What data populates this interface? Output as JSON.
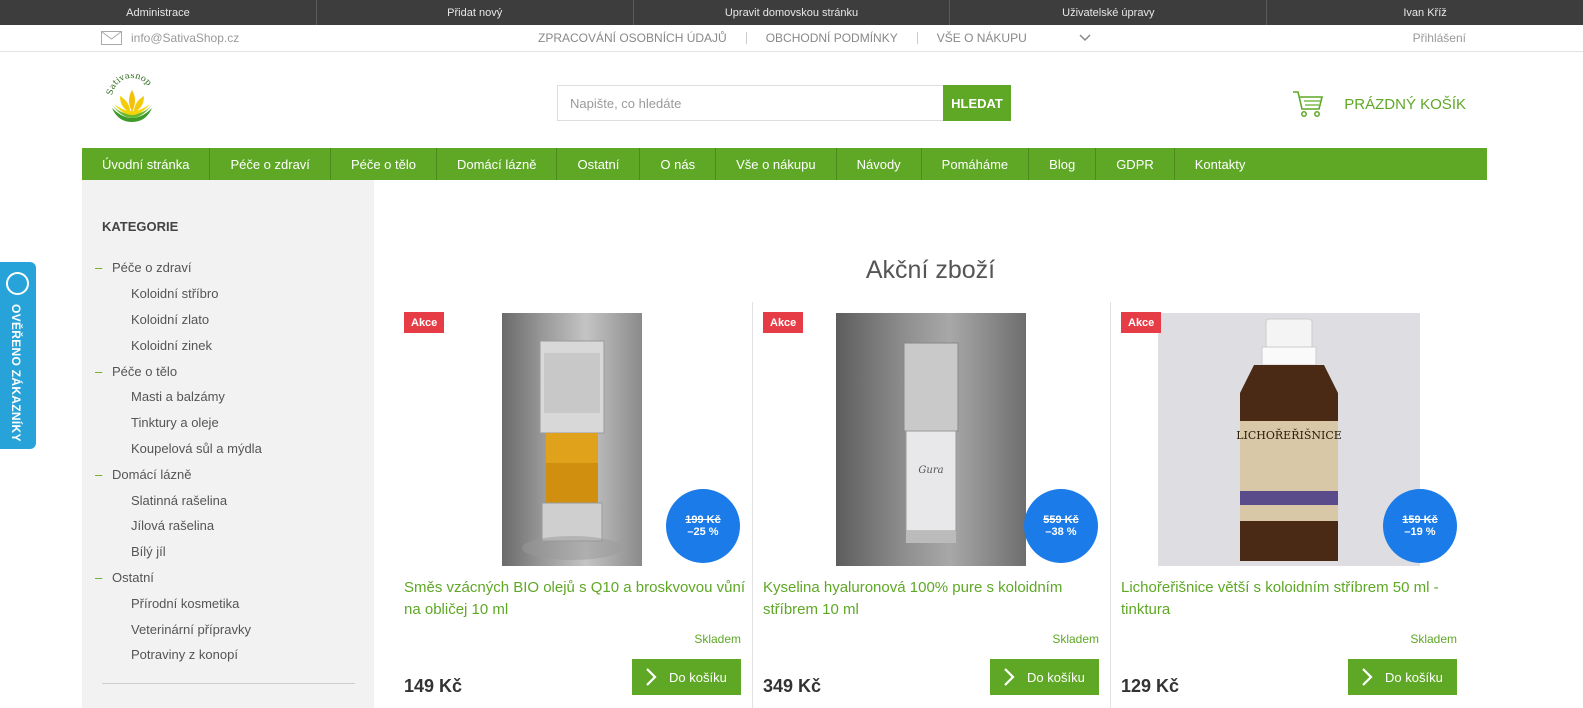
{
  "admin_bar": [
    "Administrace",
    "Přidat nový",
    "Upravit domovskou stránku",
    "Uživatelské úpravy",
    "Ivan Kříž"
  ],
  "top_bar": {
    "email": "info@SativaShop.cz",
    "links": [
      "ZPRACOVÁNÍ OSOBNÍCH ÚDAJŮ",
      "OBCHODNÍ PODMÍNKY",
      "VŠE O NÁKUPU"
    ],
    "login": "Přihlášení"
  },
  "header": {
    "logo_text": "Sativashop",
    "search_placeholder": "Napište, co hledáte",
    "search_button": "HLEDAT",
    "cart_label": "PRÁZDNÝ KOŠÍK"
  },
  "nav": [
    "Úvodní stránka",
    "Péče o zdraví",
    "Péče o tělo",
    "Domácí lázně",
    "Ostatní",
    "O nás",
    "Vše o nákupu",
    "Návody",
    "Pomáháme",
    "Blog",
    "GDPR",
    "Kontakty"
  ],
  "sidebar": {
    "title": "KATEGORIE",
    "items": [
      {
        "label": "Péče o zdraví",
        "level": 1
      },
      {
        "label": "Koloidní stříbro",
        "level": 2
      },
      {
        "label": "Koloidní zlato",
        "level": 2
      },
      {
        "label": "Koloidní zinek",
        "level": 2
      },
      {
        "label": "Péče o tělo",
        "level": 1
      },
      {
        "label": "Masti a balzámy",
        "level": 2
      },
      {
        "label": "Tinktury a oleje",
        "level": 2
      },
      {
        "label": "Koupelová sůl a mýdla",
        "level": 2
      },
      {
        "label": "Domácí lázně",
        "level": 1
      },
      {
        "label": "Slatinná rašelina",
        "level": 2
      },
      {
        "label": "Jílová rašelina",
        "level": 2
      },
      {
        "label": "Bílý jíl",
        "level": 2
      },
      {
        "label": "Ostatní",
        "level": 1
      },
      {
        "label": "Přírodní kosmetika",
        "level": 2
      },
      {
        "label": "Veterinární přípravky",
        "level": 2
      },
      {
        "label": "Potraviny z konopí",
        "level": 2
      }
    ],
    "dash": "–"
  },
  "verified_tab": "OVĚŘENO ZÁKAZNÍKY",
  "section_title": "Akční zboží",
  "products": [
    {
      "badge": "Akce",
      "name": "Směs vzácných BIO olejů s Q10 a broskvovou vůní na obličej 10 ml",
      "old_price": "199 Kč",
      "discount": "–25 %",
      "stock": "Skladem",
      "price": "149 Kč",
      "button": "Do košíku"
    },
    {
      "badge": "Akce",
      "name": "Kyselina hyaluronová 100% pure s koloidním stříbrem 10 ml",
      "old_price": "559 Kč",
      "discount": "–38 %",
      "stock": "Skladem",
      "price": "349 Kč",
      "button": "Do košíku"
    },
    {
      "badge": "Akce",
      "name": "Lichořeřišnice větší s koloidním stříbrem 50 ml - tinktura",
      "old_price": "159 Kč",
      "discount": "–19 %",
      "stock": "Skladem",
      "price": "129 Kč",
      "button": "Do košíku"
    }
  ],
  "product_label_text": "LICHOŘEŘIŠNICE",
  "colors": {
    "brand_green": "#5fa826",
    "discount_blue": "#1b7be8",
    "badge_red": "#e63c46",
    "verified_blue": "#27a3d9"
  }
}
